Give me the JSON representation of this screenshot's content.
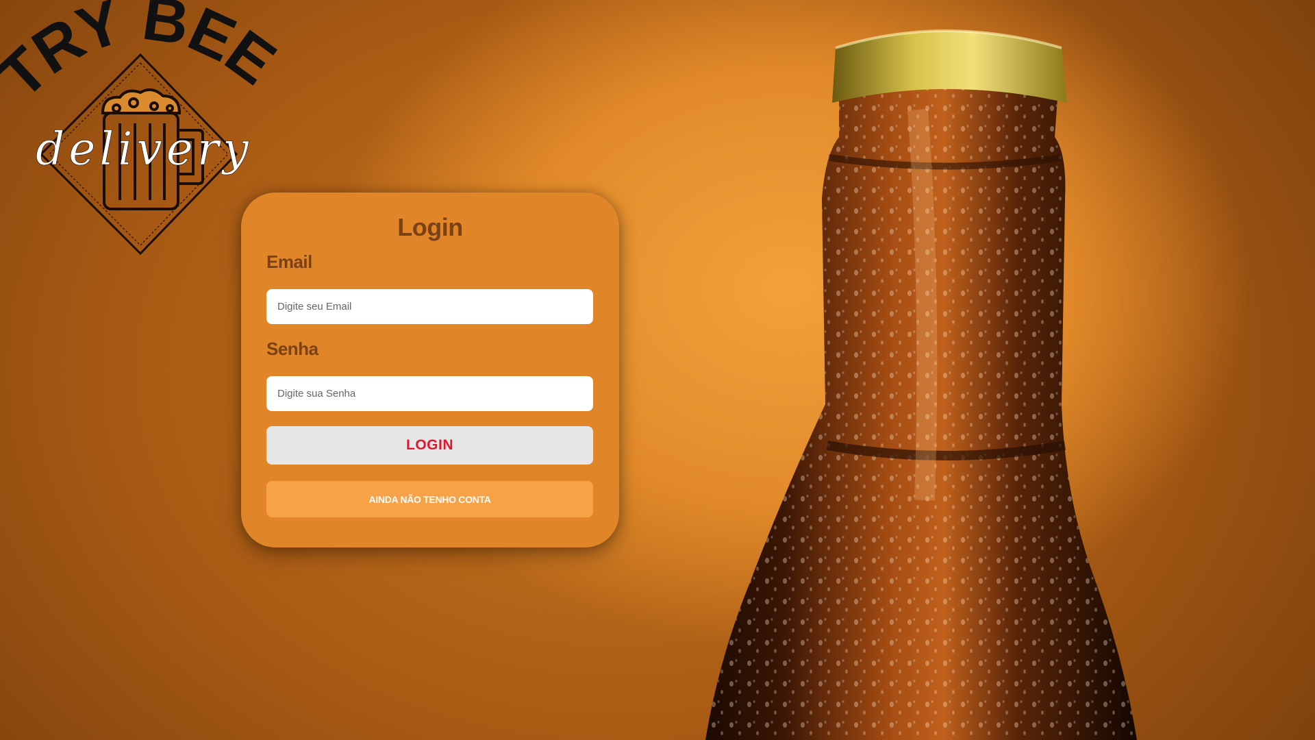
{
  "logo": {
    "text_top": "TRY BEER",
    "text_script": "delivery",
    "icon": "beer-mug-icon"
  },
  "background": {
    "image": "beer-bottle-photo",
    "accent_color": "#e08628"
  },
  "login": {
    "title": "Login",
    "email_label": "Email",
    "email_placeholder": "Digite seu Email",
    "password_label": "Senha",
    "password_placeholder": "Digite sua Senha",
    "login_button": "LOGIN",
    "signup_button": "AINDA NÃO TENHO CONTA"
  },
  "colors": {
    "card": "#e08628",
    "label_text": "#7a4116",
    "login_button_bg": "#e6e6e6",
    "login_button_text": "#e0162b",
    "signup_button_bg": "#f8a247",
    "signup_button_text": "#ffffff"
  }
}
